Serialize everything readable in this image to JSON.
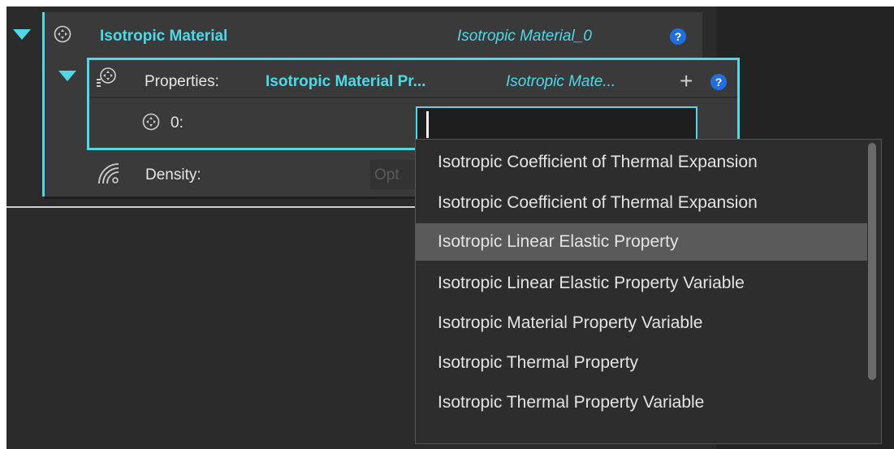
{
  "material": {
    "title": "Isotropic Material",
    "instance_name": "Isotropic Material_0",
    "help": "?"
  },
  "properties": {
    "label": "Properties:",
    "type_value": "Isotropic Material Pr...",
    "instance_value": "Isotropic Mate...",
    "add": "+",
    "help": "?"
  },
  "item0": {
    "label": "0:",
    "input_value": ""
  },
  "density": {
    "label": "Density:",
    "placeholder": "Opt"
  },
  "dropdown": {
    "items": [
      "Isotropic Coefficient of Thermal Expansion",
      "Isotropic Coefficient of Thermal Expansion",
      "Isotropic Linear Elastic Property",
      "Isotropic Linear Elastic Property Variable",
      "Isotropic Material Property Variable",
      "Isotropic Thermal Property",
      "Isotropic Thermal Property Variable"
    ],
    "highlighted_index": 2
  },
  "colors": {
    "accent": "#4fd8e6",
    "help_blue": "#1f6fe0",
    "panel": "#3a3a3a",
    "background": "#2b2b2b"
  }
}
